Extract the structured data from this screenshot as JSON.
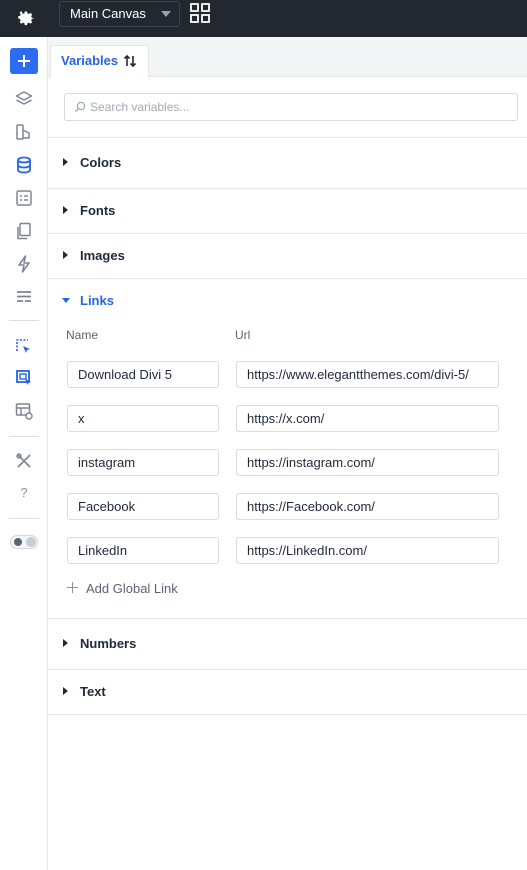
{
  "topbar": {
    "canvas_select": "Main Canvas",
    "icons": [
      "gear-icon",
      "grid-view-icon"
    ]
  },
  "rail": {
    "icons": [
      "add-icon",
      "layers-icon",
      "theme-builder-icon",
      "database-icon",
      "form-icon",
      "pages-icon",
      "lightning-icon",
      "sections-icon",
      "canvas-select-icon",
      "canvas-manage-icon",
      "preview-icon",
      "tools-icon",
      "help-icon",
      "dark-mode-toggle"
    ],
    "help_label": "?"
  },
  "tab": {
    "label": "Variables"
  },
  "search": {
    "placeholder": "Search variables..."
  },
  "sections": {
    "colors": "Colors",
    "fonts": "Fonts",
    "images": "Images",
    "links": "Links",
    "numbers": "Numbers",
    "text": "Text"
  },
  "links": {
    "col_name": "Name",
    "col_url": "Url",
    "rows": [
      {
        "name": "Download Divi 5",
        "url": "https://www.elegantthemes.com/divi-5/"
      },
      {
        "name": "x",
        "url": "https://x.com/"
      },
      {
        "name": "instagram",
        "url": "https://instagram.com/"
      },
      {
        "name": "Facebook",
        "url": "https://Facebook.com/"
      },
      {
        "name": "LinkedIn",
        "url": "https://LinkedIn.com/"
      }
    ],
    "add_label": "Add Global Link"
  },
  "colors": {
    "accent": "#2563eb",
    "topbar": "#23272f",
    "add_button": "#2b6cf0"
  }
}
